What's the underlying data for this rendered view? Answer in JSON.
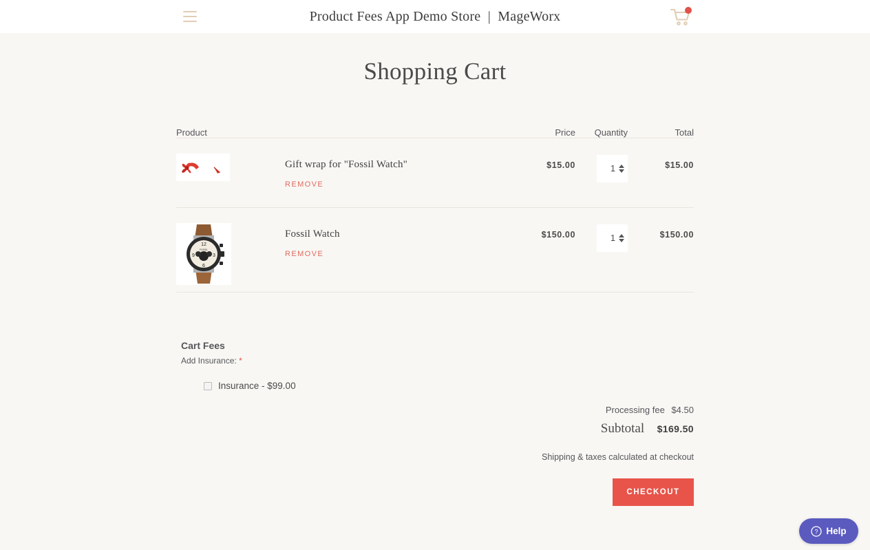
{
  "header": {
    "menu_icon": "hamburger-icon",
    "title": "Product Fees App Demo Store  |  MageWorx",
    "cart_icon": "shopping-cart-icon",
    "cart_badge": ""
  },
  "page_title": "Shopping Cart",
  "table": {
    "columns": {
      "product": "Product",
      "price": "Price",
      "quantity": "Quantity",
      "total": "Total"
    },
    "rows": [
      {
        "thumb": "gift-wrap-ribbon-image",
        "name": "Gift wrap for \"Fossil Watch\"",
        "remove_label": "REMOVE",
        "price": "$15.00",
        "quantity": "1",
        "total": "$15.00"
      },
      {
        "thumb": "fossil-watch-image",
        "name": "Fossil Watch",
        "remove_label": "REMOVE",
        "price": "$150.00",
        "quantity": "1",
        "total": "$150.00"
      }
    ]
  },
  "cart_fees": {
    "title": "Cart Fees",
    "label": "Add Insurance:",
    "required_mark": "*",
    "options": [
      {
        "label": "Insurance - $99.00",
        "checked": false
      }
    ]
  },
  "totals": {
    "processing_fee_label": "Processing fee",
    "processing_fee_amount": "$4.50",
    "subtotal_label": "Subtotal",
    "subtotal_amount": "$169.50",
    "shipping_note": "Shipping & taxes calculated at checkout",
    "checkout_label": "CHECKOUT"
  },
  "help_widget": {
    "icon": "question-circle-icon",
    "label": "Help"
  },
  "colors": {
    "background": "#f9f7f4",
    "header_bg": "#ffffff",
    "accent_red": "#e8544a",
    "remove_red": "#e06a5e",
    "menu_tan": "#e2cdb4",
    "help_purple": "#5a5abf"
  }
}
